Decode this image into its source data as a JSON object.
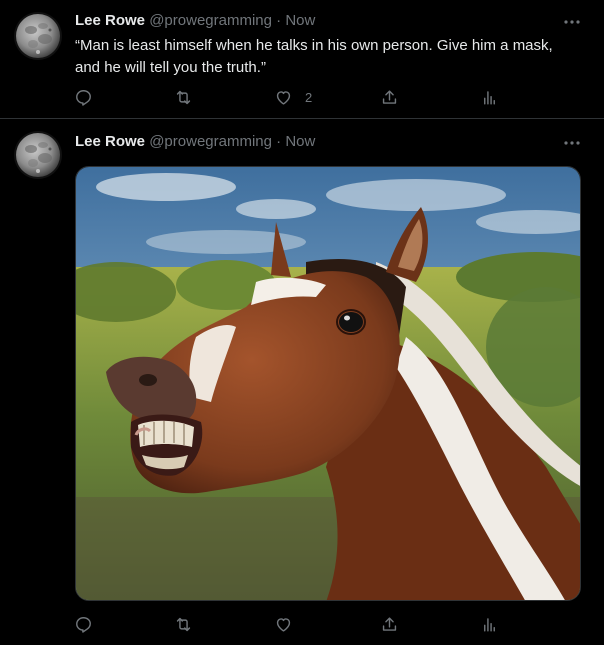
{
  "tweets": [
    {
      "author_name": "Lee Rowe",
      "handle": "@prowegramming",
      "separator": "·",
      "time": "Now",
      "text_line1": "“Man is least himself when he talks in his own person. Give him a mask,",
      "text_line2": "and he will tell you the truth.”",
      "like_count": "2",
      "icons": [
        "reply-icon",
        "retweet-icon",
        "like-icon",
        "share-icon",
        "analytics-icon",
        "more-icon"
      ]
    },
    {
      "author_name": "Lee Rowe",
      "handle": "@prowegramming",
      "separator": "·",
      "time": "Now",
      "media_description": "horse-photo",
      "icons": [
        "reply-icon",
        "retweet-icon",
        "like-icon",
        "share-icon",
        "analytics-icon",
        "more-icon"
      ]
    }
  ],
  "colors": {
    "background": "#000000",
    "primary_text": "#e7e9ea",
    "secondary_text": "#71767b",
    "divider": "#2f3336"
  }
}
